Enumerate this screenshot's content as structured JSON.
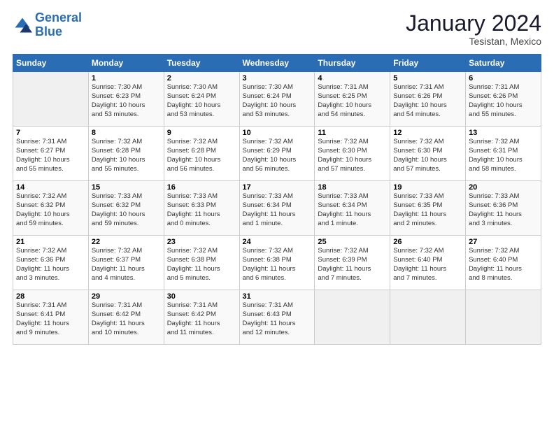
{
  "header": {
    "logo_line1": "General",
    "logo_line2": "Blue",
    "month_title": "January 2024",
    "location": "Tesistan, Mexico"
  },
  "columns": [
    "Sunday",
    "Monday",
    "Tuesday",
    "Wednesday",
    "Thursday",
    "Friday",
    "Saturday"
  ],
  "weeks": [
    [
      {
        "num": "",
        "info": ""
      },
      {
        "num": "1",
        "info": "Sunrise: 7:30 AM\nSunset: 6:23 PM\nDaylight: 10 hours\nand 53 minutes."
      },
      {
        "num": "2",
        "info": "Sunrise: 7:30 AM\nSunset: 6:24 PM\nDaylight: 10 hours\nand 53 minutes."
      },
      {
        "num": "3",
        "info": "Sunrise: 7:30 AM\nSunset: 6:24 PM\nDaylight: 10 hours\nand 53 minutes."
      },
      {
        "num": "4",
        "info": "Sunrise: 7:31 AM\nSunset: 6:25 PM\nDaylight: 10 hours\nand 54 minutes."
      },
      {
        "num": "5",
        "info": "Sunrise: 7:31 AM\nSunset: 6:26 PM\nDaylight: 10 hours\nand 54 minutes."
      },
      {
        "num": "6",
        "info": "Sunrise: 7:31 AM\nSunset: 6:26 PM\nDaylight: 10 hours\nand 55 minutes."
      }
    ],
    [
      {
        "num": "7",
        "info": "Sunrise: 7:31 AM\nSunset: 6:27 PM\nDaylight: 10 hours\nand 55 minutes."
      },
      {
        "num": "8",
        "info": "Sunrise: 7:32 AM\nSunset: 6:28 PM\nDaylight: 10 hours\nand 55 minutes."
      },
      {
        "num": "9",
        "info": "Sunrise: 7:32 AM\nSunset: 6:28 PM\nDaylight: 10 hours\nand 56 minutes."
      },
      {
        "num": "10",
        "info": "Sunrise: 7:32 AM\nSunset: 6:29 PM\nDaylight: 10 hours\nand 56 minutes."
      },
      {
        "num": "11",
        "info": "Sunrise: 7:32 AM\nSunset: 6:30 PM\nDaylight: 10 hours\nand 57 minutes."
      },
      {
        "num": "12",
        "info": "Sunrise: 7:32 AM\nSunset: 6:30 PM\nDaylight: 10 hours\nand 57 minutes."
      },
      {
        "num": "13",
        "info": "Sunrise: 7:32 AM\nSunset: 6:31 PM\nDaylight: 10 hours\nand 58 minutes."
      }
    ],
    [
      {
        "num": "14",
        "info": "Sunrise: 7:32 AM\nSunset: 6:32 PM\nDaylight: 10 hours\nand 59 minutes."
      },
      {
        "num": "15",
        "info": "Sunrise: 7:33 AM\nSunset: 6:32 PM\nDaylight: 10 hours\nand 59 minutes."
      },
      {
        "num": "16",
        "info": "Sunrise: 7:33 AM\nSunset: 6:33 PM\nDaylight: 11 hours\nand 0 minutes."
      },
      {
        "num": "17",
        "info": "Sunrise: 7:33 AM\nSunset: 6:34 PM\nDaylight: 11 hours\nand 1 minute."
      },
      {
        "num": "18",
        "info": "Sunrise: 7:33 AM\nSunset: 6:34 PM\nDaylight: 11 hours\nand 1 minute."
      },
      {
        "num": "19",
        "info": "Sunrise: 7:33 AM\nSunset: 6:35 PM\nDaylight: 11 hours\nand 2 minutes."
      },
      {
        "num": "20",
        "info": "Sunrise: 7:33 AM\nSunset: 6:36 PM\nDaylight: 11 hours\nand 3 minutes."
      }
    ],
    [
      {
        "num": "21",
        "info": "Sunrise: 7:32 AM\nSunset: 6:36 PM\nDaylight: 11 hours\nand 3 minutes."
      },
      {
        "num": "22",
        "info": "Sunrise: 7:32 AM\nSunset: 6:37 PM\nDaylight: 11 hours\nand 4 minutes."
      },
      {
        "num": "23",
        "info": "Sunrise: 7:32 AM\nSunset: 6:38 PM\nDaylight: 11 hours\nand 5 minutes."
      },
      {
        "num": "24",
        "info": "Sunrise: 7:32 AM\nSunset: 6:38 PM\nDaylight: 11 hours\nand 6 minutes."
      },
      {
        "num": "25",
        "info": "Sunrise: 7:32 AM\nSunset: 6:39 PM\nDaylight: 11 hours\nand 7 minutes."
      },
      {
        "num": "26",
        "info": "Sunrise: 7:32 AM\nSunset: 6:40 PM\nDaylight: 11 hours\nand 7 minutes."
      },
      {
        "num": "27",
        "info": "Sunrise: 7:32 AM\nSunset: 6:40 PM\nDaylight: 11 hours\nand 8 minutes."
      }
    ],
    [
      {
        "num": "28",
        "info": "Sunrise: 7:31 AM\nSunset: 6:41 PM\nDaylight: 11 hours\nand 9 minutes."
      },
      {
        "num": "29",
        "info": "Sunrise: 7:31 AM\nSunset: 6:42 PM\nDaylight: 11 hours\nand 10 minutes."
      },
      {
        "num": "30",
        "info": "Sunrise: 7:31 AM\nSunset: 6:42 PM\nDaylight: 11 hours\nand 11 minutes."
      },
      {
        "num": "31",
        "info": "Sunrise: 7:31 AM\nSunset: 6:43 PM\nDaylight: 11 hours\nand 12 minutes."
      },
      {
        "num": "",
        "info": ""
      },
      {
        "num": "",
        "info": ""
      },
      {
        "num": "",
        "info": ""
      }
    ]
  ]
}
